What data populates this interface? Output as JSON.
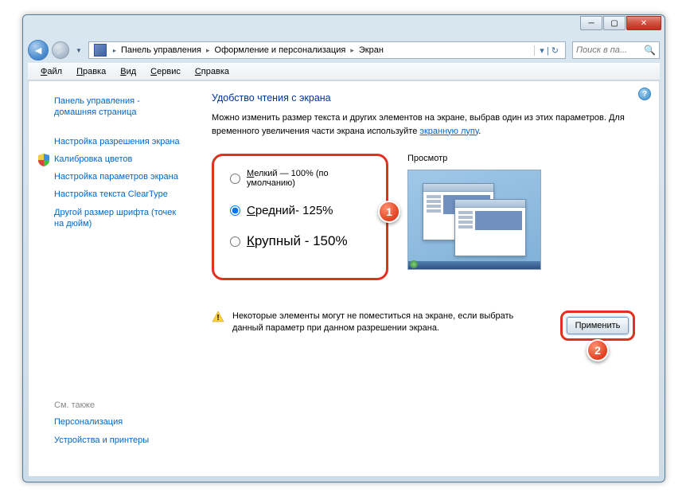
{
  "breadcrumb": {
    "item1": "Панель управления",
    "item2": "Оформление и персонализация",
    "item3": "Экран"
  },
  "search": {
    "placeholder": "Поиск в па..."
  },
  "menu": {
    "file": "айл",
    "file_u": "Ф",
    "edit": "равка",
    "edit_u": "П",
    "view": "ид",
    "view_u": "В",
    "tools": "ервис",
    "tools_u": "С",
    "help": "правка",
    "help_u": "С"
  },
  "sidebar": {
    "home": "Панель управления - домашняя страница",
    "resolution": "Настройка разрешения экрана",
    "calibration": "Калибровка цветов",
    "params": "Настройка параметров экрана",
    "cleartype": "Настройка текста ClearType",
    "dpi": "Другой размер шрифта (точек на дюйм)",
    "seealso": "См. также",
    "personalize": "Персонализация",
    "devices": "Устройства и принтеры"
  },
  "main": {
    "title": "Удобство чтения с экрана",
    "desc1": "Можно изменить размер текста и других элементов на экране, выбрав один из этих параметров. Для временного увеличения части экрана используйте ",
    "magnifier_link": "экранную лупу",
    "desc_end": ".",
    "opt_small_u": "М",
    "opt_small": "елкий — 100% (по умолчанию)",
    "opt_med_u": "С",
    "opt_med": "редний- 125%",
    "opt_large_u": "К",
    "opt_large": "рупный - 150%",
    "preview_label": "Просмотр",
    "warning": "Некоторые элементы могут не поместиться на экране, если выбрать данный параметр при данном разрешении экрана.",
    "apply": "Применить"
  },
  "annotations": {
    "a1": "1",
    "a2": "2"
  }
}
